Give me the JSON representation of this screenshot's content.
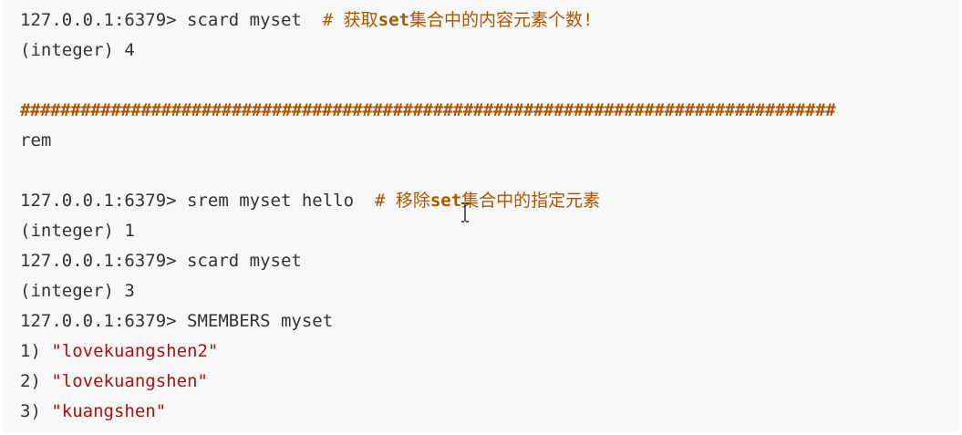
{
  "lines": [
    {
      "parts": [
        {
          "t": "127.0.0.1:6379> scard myset  ",
          "c": ""
        },
        {
          "t": "# 获取",
          "c": "comment"
        },
        {
          "t": "set",
          "c": "comment kw"
        },
        {
          "t": "集合中的内容元素个数!",
          "c": "comment"
        }
      ]
    },
    {
      "parts": [
        {
          "t": "(integer) 4",
          "c": ""
        }
      ]
    },
    {
      "parts": [
        {
          "t": "",
          "c": ""
        }
      ]
    },
    {
      "parts": [
        {
          "t": "#################################################################################",
          "c": "hash"
        }
      ]
    },
    {
      "parts": [
        {
          "t": "rem",
          "c": ""
        }
      ]
    },
    {
      "parts": [
        {
          "t": "",
          "c": ""
        }
      ]
    },
    {
      "parts": [
        {
          "t": "127.0.0.1:6379> srem myset hello  ",
          "c": ""
        },
        {
          "t": "# 移除",
          "c": "comment"
        },
        {
          "t": "set",
          "c": "comment kw"
        },
        {
          "t": "集合中的指定元素",
          "c": "comment"
        }
      ]
    },
    {
      "parts": [
        {
          "t": "(integer) 1",
          "c": ""
        }
      ]
    },
    {
      "parts": [
        {
          "t": "127.0.0.1:6379> scard myset",
          "c": ""
        }
      ]
    },
    {
      "parts": [
        {
          "t": "(integer) 3",
          "c": ""
        }
      ]
    },
    {
      "parts": [
        {
          "t": "127.0.0.1:6379> SMEMBERS myset",
          "c": ""
        }
      ]
    },
    {
      "parts": [
        {
          "t": "1) ",
          "c": ""
        },
        {
          "t": "\"lovekuangshen2\"",
          "c": "str"
        }
      ]
    },
    {
      "parts": [
        {
          "t": "2) ",
          "c": ""
        },
        {
          "t": "\"lovekuangshen\"",
          "c": "str"
        }
      ]
    },
    {
      "parts": [
        {
          "t": "3) ",
          "c": ""
        },
        {
          "t": "\"kuangshen\"",
          "c": "str"
        }
      ]
    }
  ]
}
